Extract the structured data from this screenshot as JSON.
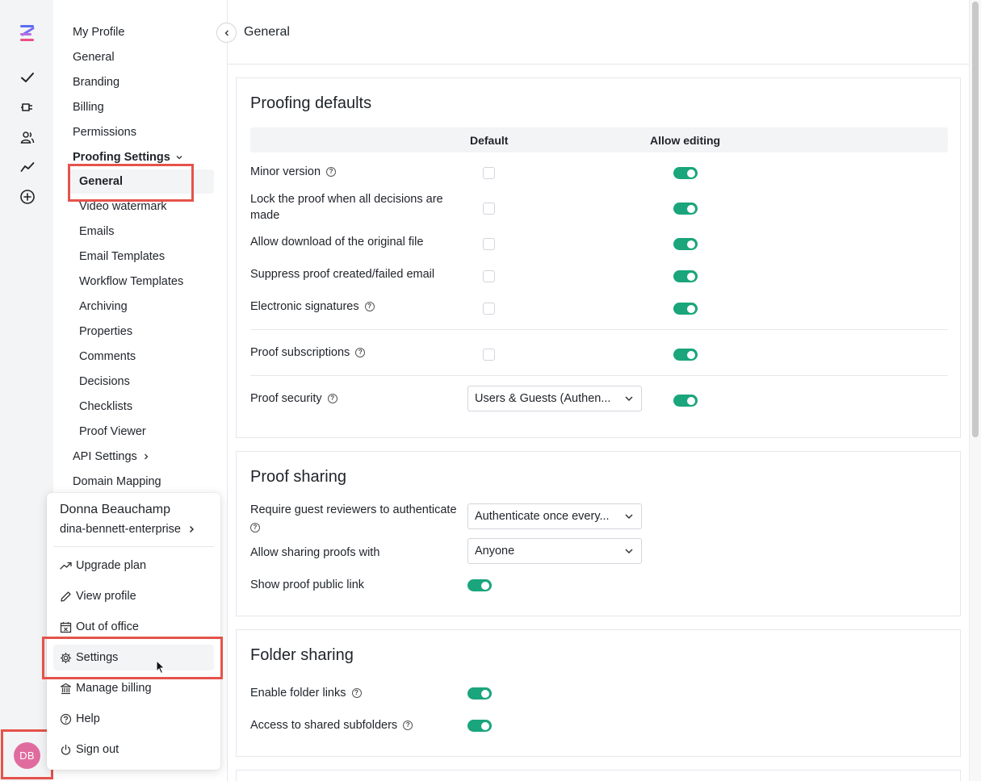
{
  "user": {
    "initials": "DB",
    "name": "Donna Beauchamp",
    "org": "dina-bennett-enterprise"
  },
  "settings_nav": {
    "items": [
      {
        "label": "My Profile"
      },
      {
        "label": "General"
      },
      {
        "label": "Branding"
      },
      {
        "label": "Billing"
      },
      {
        "label": "Permissions"
      }
    ],
    "proofing_settings": {
      "label": "Proofing Settings",
      "sub_items": [
        {
          "label": "General"
        },
        {
          "label": "Video watermark"
        },
        {
          "label": "Emails"
        },
        {
          "label": "Email Templates"
        },
        {
          "label": "Workflow Templates"
        },
        {
          "label": "Archiving"
        },
        {
          "label": "Properties"
        },
        {
          "label": "Comments"
        },
        {
          "label": "Decisions"
        },
        {
          "label": "Checklists"
        },
        {
          "label": "Proof Viewer"
        }
      ]
    },
    "api_settings": "API Settings",
    "domain_mapping": "Domain Mapping"
  },
  "header": {
    "title": "General"
  },
  "proofing_defaults": {
    "title": "Proofing defaults",
    "col_default": "Default",
    "col_allow_editing": "Allow editing",
    "rows": [
      {
        "label": "Minor version",
        "help": true,
        "default": false,
        "allow_editing": true
      },
      {
        "label": "Lock the proof when all decisions are made",
        "help": false,
        "default": false,
        "allow_editing": true
      },
      {
        "label": "Allow download of the original file",
        "help": false,
        "default": false,
        "allow_editing": true
      },
      {
        "label": "Suppress proof created/failed email",
        "help": false,
        "default": false,
        "allow_editing": true
      },
      {
        "label": "Electronic signatures",
        "help": true,
        "default": false,
        "allow_editing": true
      },
      {
        "label": "Proof subscriptions",
        "help": true,
        "default": false,
        "allow_editing": true
      }
    ],
    "proof_security": {
      "label": "Proof security",
      "value": "Users & Guests (Authen...",
      "allow_editing": true
    }
  },
  "proof_sharing": {
    "title": "Proof sharing",
    "require_auth": {
      "label": "Require guest reviewers to authenticate",
      "value": "Authenticate once every..."
    },
    "allow_sharing": {
      "label": "Allow sharing proofs with",
      "value": "Anyone"
    },
    "public_link": {
      "label": "Show proof public link",
      "enabled": true
    }
  },
  "folder_sharing": {
    "title": "Folder sharing",
    "folder_links": {
      "label": "Enable folder links",
      "enabled": true
    },
    "shared_subfolders": {
      "label": "Access to shared subfolders",
      "enabled": true
    }
  },
  "user_menu": {
    "items": [
      {
        "label": "Upgrade plan",
        "icon": "trending-up-icon"
      },
      {
        "label": "View profile",
        "icon": "pencil-icon"
      },
      {
        "label": "Out of office",
        "icon": "calendar-x-icon"
      },
      {
        "label": "Settings",
        "icon": "gear-icon"
      },
      {
        "label": "Manage billing",
        "icon": "bank-icon"
      },
      {
        "label": "Help",
        "icon": "help-circle-icon"
      },
      {
        "label": "Sign out",
        "icon": "power-icon"
      }
    ]
  },
  "colors": {
    "accent": "#1aa57c",
    "highlight": "#e5534b",
    "avatar": "#e06c9f"
  }
}
